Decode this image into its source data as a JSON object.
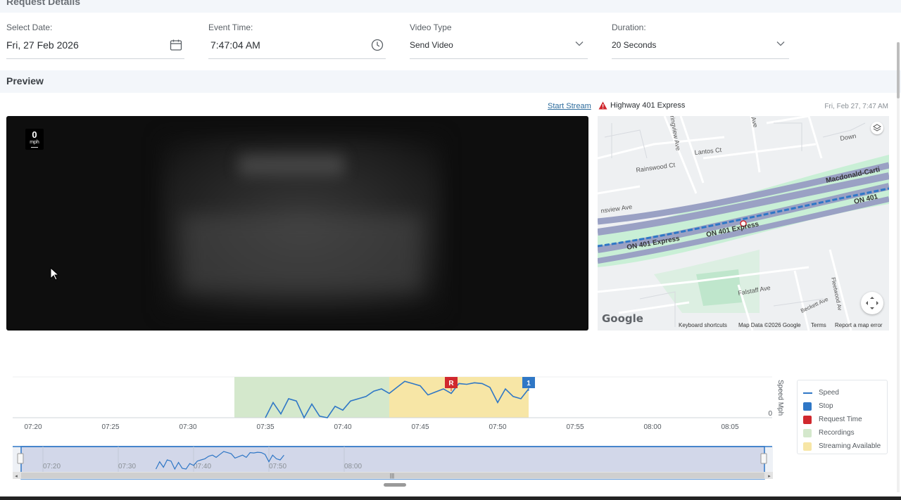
{
  "section": {
    "request_title": "Request Details",
    "preview_title": "Preview"
  },
  "fields": {
    "date": {
      "label": "Select Date:",
      "value": "Fri, 27 Feb 2026"
    },
    "time": {
      "label": "Event Time:",
      "value": "7:47:04 AM"
    },
    "video_type": {
      "label": "Video Type",
      "value": "Send Video"
    },
    "duration": {
      "label": "Duration:",
      "value": "20 Seconds"
    }
  },
  "video": {
    "start_stream": "Start Stream",
    "speed_value": "0",
    "speed_unit": "mph"
  },
  "map": {
    "location": "Highway 401 Express",
    "timestamp": "Fri, Feb 27, 7:47 AM",
    "labels": {
      "rainswood": "Rainswood Ct",
      "lantos": "Lantos Ct",
      "springview": "ringview Ave",
      "down": "Down",
      "macdonald": "Macdonald-Carti",
      "on401_1": "ON 401 Express",
      "on401_2": "ON 401 Express",
      "on401_3": "ON 401",
      "insview": "nsview Ave",
      "falstaff": "Falstaff Ave",
      "beckett": "Beckett Ave",
      "fleetwood": "Fleetwood Av",
      "ave": "Ave"
    },
    "footer": {
      "google": "Google",
      "shortcuts": "Keyboard shortcuts",
      "data": "Map Data ©2026 Google",
      "terms": "Terms",
      "report": "Report a map error"
    },
    "colors": {
      "highway": "#9aa1c4",
      "route": "#2f77c6",
      "park": "#c9efd6"
    }
  },
  "chart_data": {
    "type": "line",
    "ylabel": "Speed Mph",
    "y_tick": "0",
    "x_ticks": [
      "07:20",
      "07:25",
      "07:30",
      "07:35",
      "07:40",
      "07:45",
      "07:50",
      "07:55",
      "08:00",
      "08:05"
    ],
    "navigator_ticks": [
      "07:20",
      "07:30",
      "07:40",
      "07:50",
      "08:00"
    ],
    "markers": [
      {
        "label": "R",
        "name": "Request Time",
        "time": "07:47"
      },
      {
        "label": "1",
        "name": "Stop",
        "time": "07:52"
      }
    ],
    "bands": [
      {
        "name": "Recordings",
        "from": "07:33",
        "to": "07:43",
        "color": "#d4e8cc"
      },
      {
        "name": "Streaming Available",
        "from": "07:43",
        "to": "07:52",
        "color": "#f7e6a6"
      }
    ],
    "series": [
      {
        "name": "Speed",
        "color": "#2f77c6",
        "x": [
          "07:35",
          "07:35.5",
          "07:36",
          "07:36.5",
          "07:37",
          "07:37.5",
          "07:38",
          "07:38.5",
          "07:39",
          "07:39.5",
          "07:40",
          "07:40.5",
          "07:41",
          "07:41.5",
          "07:42",
          "07:42.5",
          "07:43",
          "07:43.5",
          "07:44",
          "07:44.5",
          "07:45",
          "07:45.5",
          "07:46",
          "07:46.5",
          "07:47",
          "07:47.5",
          "07:48",
          "07:48.5",
          "07:49",
          "07:49.5",
          "07:50",
          "07:50.5",
          "07:51",
          "07:51.5",
          "07:52"
        ],
        "values": [
          0,
          20,
          5,
          25,
          22,
          0,
          18,
          2,
          0,
          15,
          10,
          22,
          25,
          28,
          35,
          38,
          32,
          40,
          48,
          45,
          42,
          30,
          34,
          38,
          32,
          45,
          44,
          46,
          45,
          40,
          20,
          38,
          28,
          25,
          38
        ]
      }
    ],
    "legend": [
      "Speed",
      "Stop",
      "Request Time",
      "Recordings",
      "Streaming Available"
    ],
    "legend_colors": {
      "Speed": "#2f77c6",
      "Stop": "#2f77c6",
      "Request Time": "#d0282e",
      "Recordings": "#d4e8cc",
      "Streaming Available": "#f7e6a6"
    }
  }
}
